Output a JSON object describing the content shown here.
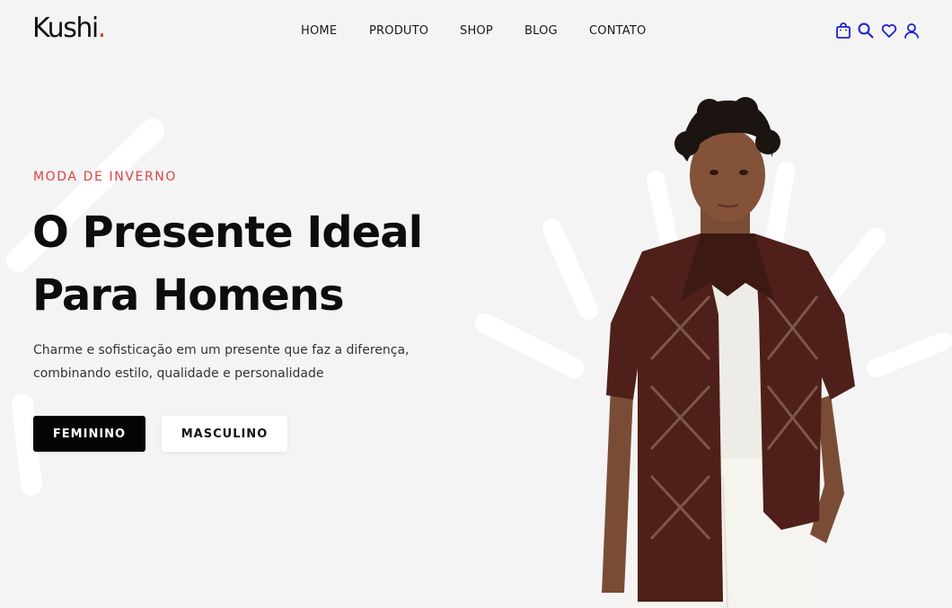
{
  "header": {
    "logo_text": "Kushi",
    "logo_dot": ".",
    "nav": [
      "HOME",
      "PRODUTO",
      "SHOP",
      "BLOG",
      "CONTATO"
    ],
    "icons": [
      "shopping-bag-icon",
      "search-icon",
      "heart-icon",
      "user-icon"
    ],
    "icon_color": "#1f1fd1"
  },
  "hero": {
    "eyebrow": "MODA DE INVERNO",
    "title_line1": "O Presente Ideal",
    "title_line2": "Para Homens",
    "subtitle_line1": "Charme e sofisticação em um presente que faz a diferença,",
    "subtitle_line2": "combinando estilo, qualidade e personalidade",
    "buttons": {
      "primary": "FEMININO",
      "secondary": "MASCULINO"
    }
  },
  "colors": {
    "background": "#f4f4f4",
    "accent": "#d94343",
    "primary_button": "#050505"
  }
}
